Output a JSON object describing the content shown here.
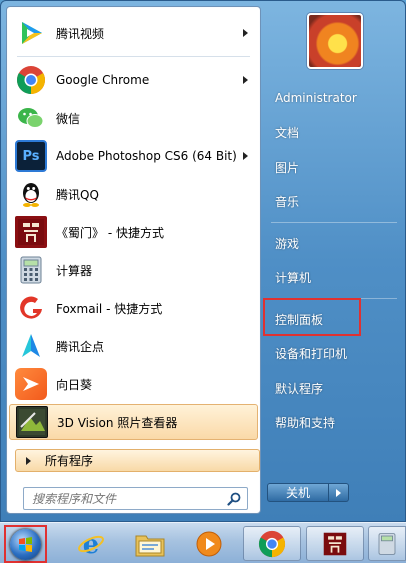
{
  "programs": [
    {
      "label": "腾讯视频",
      "icon": "tencent-video-icon",
      "has_submenu": true
    },
    {
      "label": "Google Chrome",
      "icon": "chrome-icon",
      "has_submenu": true
    },
    {
      "label": "微信",
      "icon": "wechat-icon",
      "has_submenu": false
    },
    {
      "label": "Adobe Photoshop CS6 (64 Bit)",
      "icon": "photoshop-icon",
      "has_submenu": true
    },
    {
      "label": "腾讯QQ",
      "icon": "qq-icon",
      "has_submenu": false
    },
    {
      "label": "《蜀门》 - 快捷方式",
      "icon": "shumen-game-icon",
      "has_submenu": false
    },
    {
      "label": "计算器",
      "icon": "calculator-icon",
      "has_submenu": false
    },
    {
      "label": "Foxmail - 快捷方式",
      "icon": "foxmail-icon",
      "has_submenu": false
    },
    {
      "label": "腾讯企点",
      "icon": "tencent-qidian-icon",
      "has_submenu": false
    },
    {
      "label": "向日葵",
      "icon": "sunlogin-icon",
      "has_submenu": false
    },
    {
      "label": "3D Vision 照片查看器",
      "icon": "3d-vision-icon",
      "has_submenu": false
    }
  ],
  "all_programs_label": "所有程序",
  "search": {
    "placeholder": "搜索程序和文件"
  },
  "user": {
    "name": "Administrator"
  },
  "right_menu": {
    "documents": "文档",
    "pictures": "图片",
    "music": "音乐",
    "games": "游戏",
    "computer": "计算机",
    "control_panel": "控制面板",
    "devices_printers": "设备和打印机",
    "default_programs": "默认程序",
    "help_support": "帮助和支持"
  },
  "shutdown": {
    "label": "关机"
  },
  "taskbar": {
    "items": [
      "start-orb",
      "ie-icon",
      "explorer-icon",
      "media-player-icon",
      "chrome-icon",
      "shumen-game-icon",
      "calculator-icon"
    ]
  },
  "colors": {
    "highlight_red": "#e03131",
    "hover_orange": "#fad9a8"
  }
}
